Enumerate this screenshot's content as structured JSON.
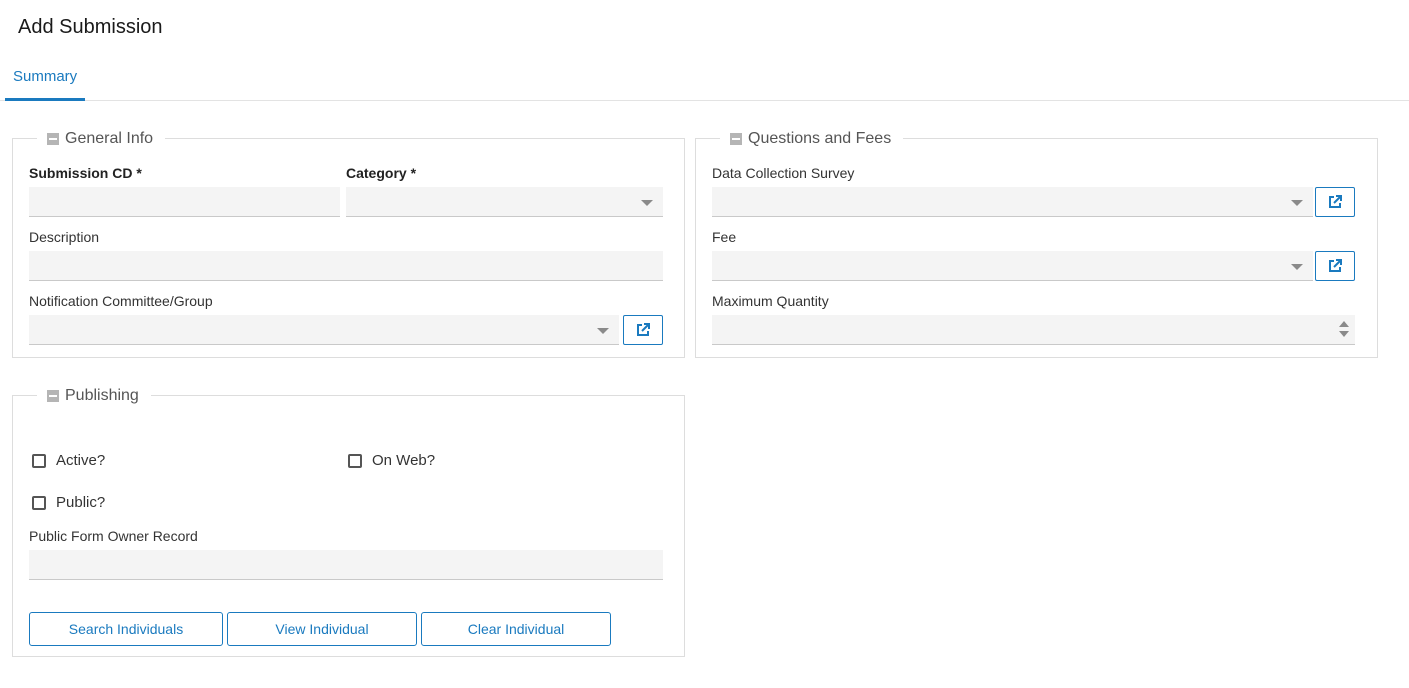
{
  "page": {
    "title": "Add Submission"
  },
  "tabs": [
    {
      "label": "Summary",
      "active": true
    }
  ],
  "colors": {
    "accent": "#1a7abf",
    "field_bg": "#f4f4f4",
    "border": "#dddddd"
  },
  "general_info": {
    "legend": "General Info",
    "submission_cd": {
      "label": "Submission CD *",
      "value": ""
    },
    "category": {
      "label": "Category *",
      "value": ""
    },
    "description": {
      "label": "Description",
      "value": ""
    },
    "notification": {
      "label": "Notification Committee/Group",
      "value": ""
    }
  },
  "questions_fees": {
    "legend": "Questions and Fees",
    "survey": {
      "label": "Data Collection Survey",
      "value": ""
    },
    "fee": {
      "label": "Fee",
      "value": ""
    },
    "max_qty": {
      "label": "Maximum Quantity",
      "value": ""
    }
  },
  "publishing": {
    "legend": "Publishing",
    "active": {
      "label": "Active?",
      "checked": false
    },
    "on_web": {
      "label": "On Web?",
      "checked": false
    },
    "public": {
      "label": "Public?",
      "checked": false
    },
    "owner_record": {
      "label": "Public Form Owner Record",
      "value": ""
    },
    "buttons": {
      "search": "Search Individuals",
      "view": "View Individual",
      "clear": "Clear Individual"
    }
  },
  "icons": {
    "open_link": "external-link-icon",
    "collapse": "collapse-icon"
  }
}
